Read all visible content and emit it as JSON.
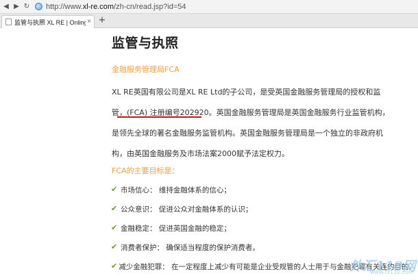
{
  "browser": {
    "back_icon": "back-arrow-icon",
    "forward_icon": "forward-arrow-icon",
    "reload_icon": "reload-icon",
    "url_prefix": "http://www.",
    "url_host": "xl-re.com",
    "url_path": "/zh-cn/read.jsp?id=54",
    "tab_title": "监管与执照 XL RE | Onling Fo",
    "tab_close": "×",
    "new_tab": "+"
  },
  "page": {
    "title": "监管与执照",
    "section_title": "金融服务管理局FCA",
    "paragraph_lines": [
      "XL RE英国有限公司是XL RE Ltd的子公司，是受英国金融服务管理局的授权和监",
      "管，(FCA) 注册编号202920。英国金融服务管理局是英国金融服务行业监管机构，",
      "是领先全球的著名金融服务监管机构。英国金融服务管理局是一个独立的非政府机",
      "构，由英国金融服务及市场法案2000赋予法定权力。"
    ],
    "goals_title": "FCA的主要目标是：",
    "goals": [
      "市场信心：  维持金融体系的信心；",
      "公众意识：  促进公众对金融体系的认识；",
      "金融稳定：  促进英国金融的稳定；",
      "消费者保护：  确保适当程度的保护消费者。",
      "减少金融犯罪：  在一定程度上减少有可能是企业受规管的人士用于与金融犯罪有关连的目的。"
    ]
  },
  "watermark": {
    "text": "外汇110网",
    "sub": "www.fx110.com"
  }
}
